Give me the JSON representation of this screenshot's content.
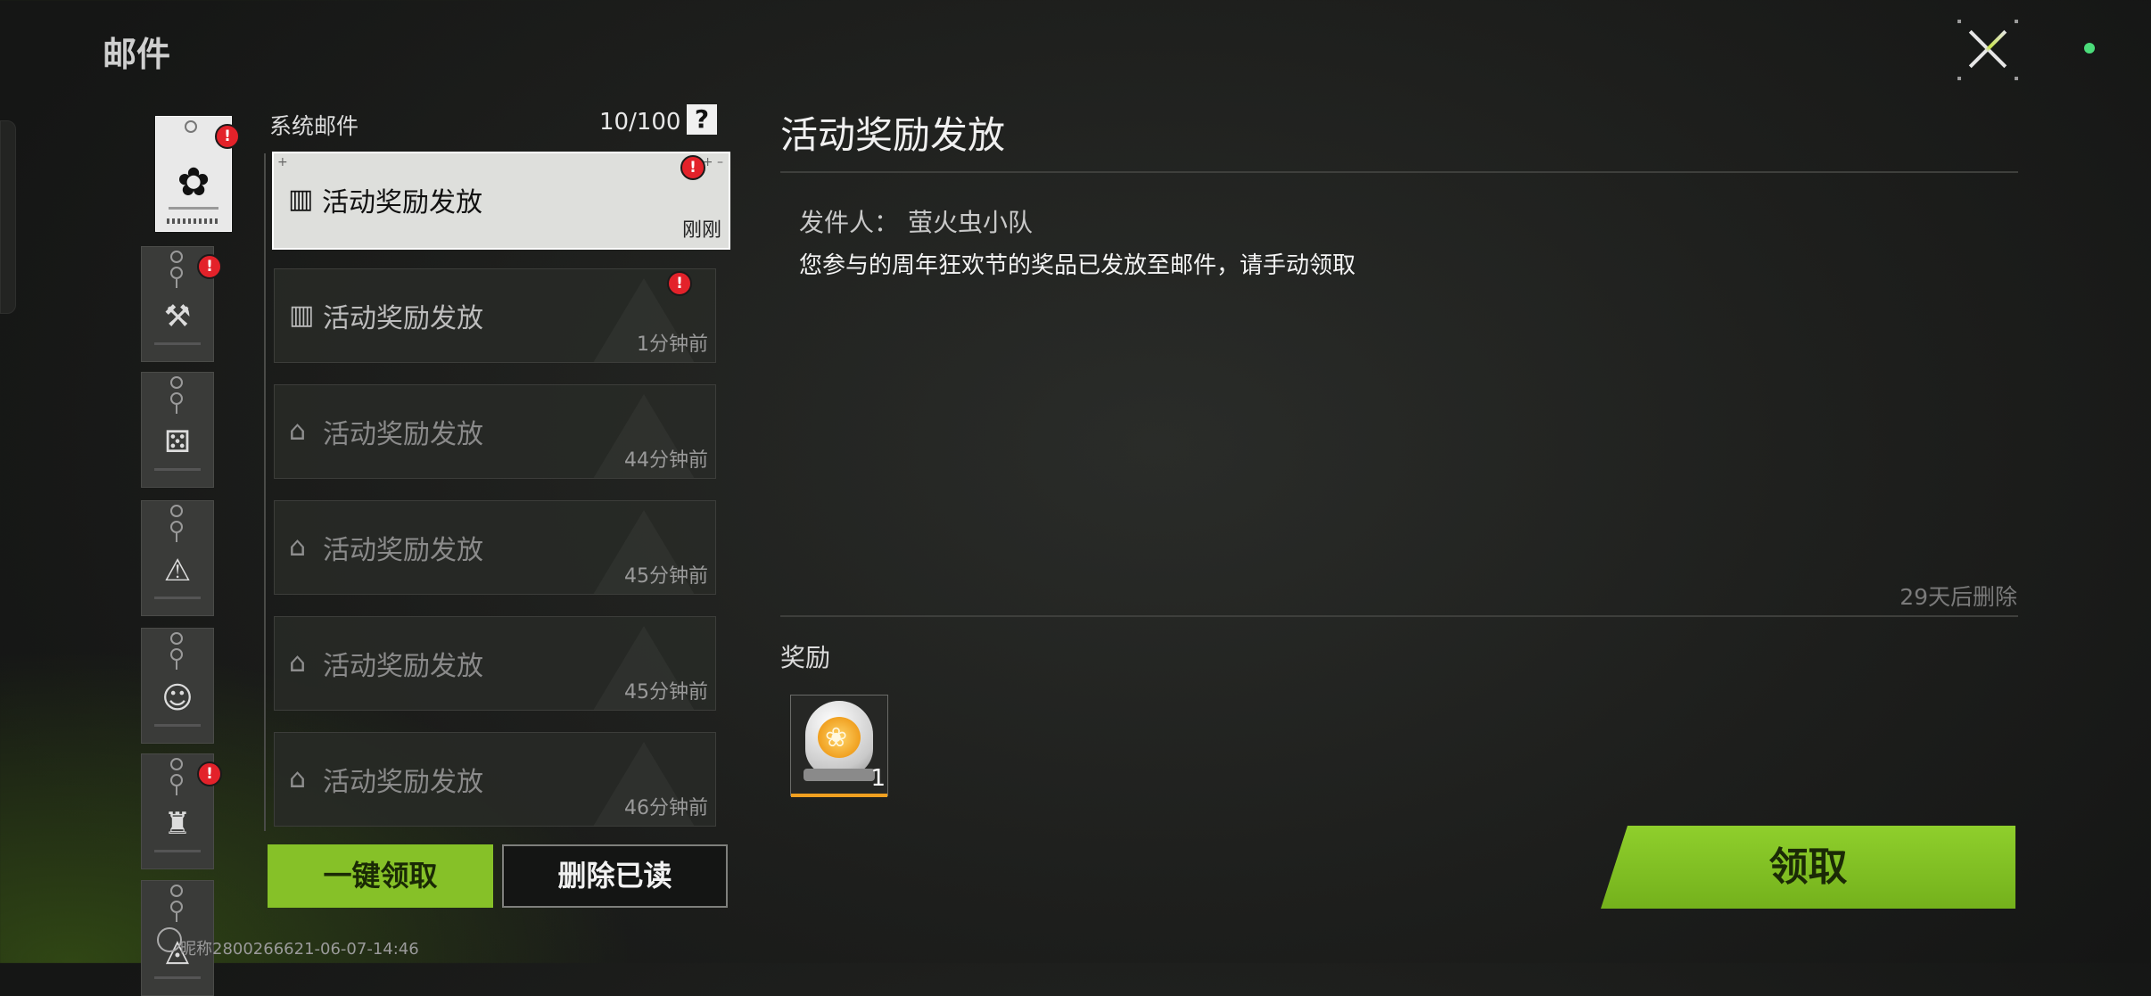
{
  "page_title": "邮件",
  "list": {
    "title": "系统邮件",
    "count": "10/100",
    "help_glyph": "?",
    "items": [
      {
        "title": "活动奖励发放",
        "time": "刚刚",
        "icon": "gift-icon",
        "state": "selected",
        "unread": true
      },
      {
        "title": "活动奖励发放",
        "time": "1分钟前",
        "icon": "gift-icon",
        "state": "unread",
        "unread": true
      },
      {
        "title": "活动奖励发放",
        "time": "44分钟前",
        "icon": "opened-gift-icon",
        "state": "read",
        "unread": false
      },
      {
        "title": "活动奖励发放",
        "time": "45分钟前",
        "icon": "opened-gift-icon",
        "state": "read",
        "unread": false
      },
      {
        "title": "活动奖励发放",
        "time": "45分钟前",
        "icon": "opened-gift-icon",
        "state": "read",
        "unread": false
      },
      {
        "title": "活动奖励发放",
        "time": "46分钟前",
        "icon": "opened-gift-icon",
        "state": "read",
        "unread": false
      }
    ],
    "claim_all_label": "一键领取",
    "delete_read_label": "删除已读"
  },
  "categories": [
    {
      "icon": "gear-icon",
      "glyph": "✿",
      "active": true,
      "alert": true
    },
    {
      "icon": "hammer-icon",
      "glyph": "⚒",
      "active": false,
      "alert": true
    },
    {
      "icon": "dice-icon",
      "glyph": "⚄",
      "active": false,
      "alert": false
    },
    {
      "icon": "warning-icon",
      "glyph": "⚠",
      "active": false,
      "alert": false
    },
    {
      "icon": "character-icon",
      "glyph": "☺",
      "active": false,
      "alert": false
    },
    {
      "icon": "backpack-icon",
      "glyph": "♜",
      "active": false,
      "alert": true
    },
    {
      "icon": "triangle-emblem-icon",
      "glyph": "◬",
      "active": false,
      "alert": false
    }
  ],
  "alert_glyph": "!",
  "detail": {
    "title": "活动奖励发放",
    "sender_label": "发件人：",
    "sender": "萤火虫小队",
    "body": "您参与的周年狂欢节的奖品已发放至邮件，请手动领取",
    "expire": "29天后删除",
    "reward_label": "奖励",
    "rewards": [
      {
        "icon": "egg-capsule-icon",
        "quantity": "1",
        "rarity_color": "#f0a020"
      }
    ],
    "claim_label": "领取"
  },
  "footer_id": "昵称2800266621-06-07-14:46",
  "colors": {
    "accent": "#86c128",
    "alert": "#e3222a",
    "status_dot": "#4bdc7a"
  }
}
